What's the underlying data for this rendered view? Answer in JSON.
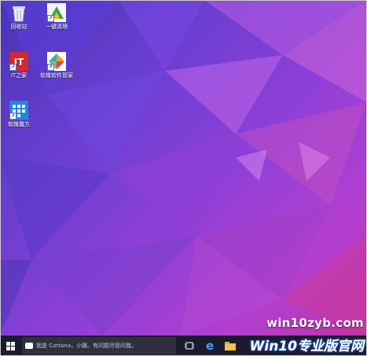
{
  "desktop_icons": [
    {
      "label": "回收站",
      "icon": "recycle-bin-icon"
    },
    {
      "label": "一键清理",
      "icon": "one-click-cleanup-icon"
    },
    {
      "label": "IT之家",
      "icon": "ithome-icon"
    },
    {
      "label": "软媒软件管家",
      "icon": "software-manager-icon"
    },
    {
      "label": "软媒魔方",
      "icon": "ruanmei-mofang-icon"
    }
  ],
  "taskbar": {
    "start_icon": "windows-logo-icon",
    "search_placeholder": "我是 Cortana，小娜。有问题尽管问我。",
    "task_view_icon": "task-view-icon",
    "edge_icon": "edge-icon",
    "explorer_icon": "file-explorer-icon"
  },
  "watermark": {
    "site": "win10zyb.com",
    "brand": "Win10专业版官网"
  },
  "colors": {
    "taskbar": "#1b1b2e",
    "accent": "#2a6ad8"
  }
}
